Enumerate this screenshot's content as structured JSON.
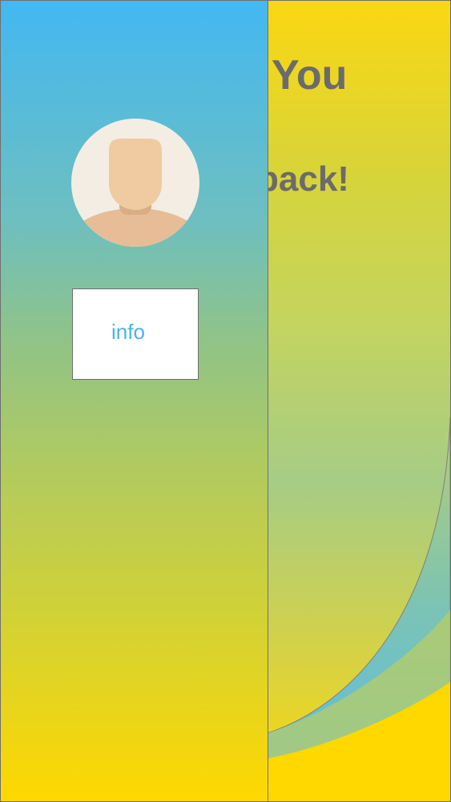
{
  "main": {
    "title": "You",
    "subtitle": "back!"
  },
  "drawer": {
    "info_button_label": "info",
    "avatar_icon": "default-user-avatar-icon"
  },
  "colors": {
    "drawer_top": "#43b8f2",
    "yellow": "#ffd800",
    "text_gray": "#6b6b6b",
    "info_text": "#4ab4ea"
  }
}
